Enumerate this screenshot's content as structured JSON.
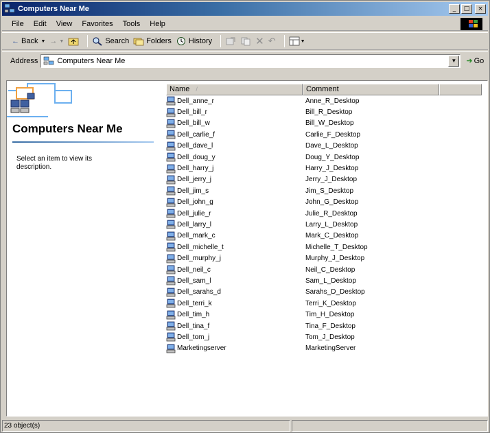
{
  "window": {
    "title": "Computers Near Me",
    "minimize": "_",
    "maximize": "□",
    "close": "×"
  },
  "menu": [
    "File",
    "Edit",
    "View",
    "Favorites",
    "Tools",
    "Help"
  ],
  "toolbar": {
    "back": "Back",
    "back_icon": "←",
    "forward_icon": "→",
    "search": "Search",
    "folders": "Folders",
    "history": "History"
  },
  "address": {
    "label": "Address",
    "value": "Computers Near Me",
    "go": "Go"
  },
  "left_pane": {
    "heading": "Computers Near Me",
    "description": "Select an item to view its description."
  },
  "columns": {
    "name": "Name",
    "comment": "Comment"
  },
  "items": [
    {
      "name": "Dell_anne_r",
      "comment": "Anne_R_Desktop"
    },
    {
      "name": "Dell_bill_r",
      "comment": "Bill_R_Desktop"
    },
    {
      "name": "Dell_bill_w",
      "comment": "Bill_W_Desktop"
    },
    {
      "name": "Dell_carlie_f",
      "comment": "Carlie_F_Desktop"
    },
    {
      "name": "Dell_dave_l",
      "comment": "Dave_L_Desktop"
    },
    {
      "name": "Dell_doug_y",
      "comment": "Doug_Y_Desktop"
    },
    {
      "name": "Dell_harry_j",
      "comment": "Harry_J_Desktop"
    },
    {
      "name": "Dell_jerry_j",
      "comment": "Jerry_J_Desktop"
    },
    {
      "name": "Dell_jim_s",
      "comment": "Jim_S_Desktop"
    },
    {
      "name": "Dell_john_g",
      "comment": "John_G_Desktop"
    },
    {
      "name": "Dell_julie_r",
      "comment": "Julie_R_Desktop"
    },
    {
      "name": "Dell_larry_l",
      "comment": "Larry_L_Desktop"
    },
    {
      "name": "Dell_mark_c",
      "comment": "Mark_C_Desktop"
    },
    {
      "name": "Dell_michelle_t",
      "comment": "Michelle_T_Desktop"
    },
    {
      "name": "Dell_murphy_j",
      "comment": "Murphy_J_Desktop"
    },
    {
      "name": "Dell_neil_c",
      "comment": "Neil_C_Desktop"
    },
    {
      "name": "Dell_sam_l",
      "comment": "Sam_L_Desktop"
    },
    {
      "name": "Dell_sarahs_d",
      "comment": "Sarahs_D_Desktop"
    },
    {
      "name": "Dell_terri_k",
      "comment": "Terri_K_Desktop"
    },
    {
      "name": "Dell_tim_h",
      "comment": "Tim_H_Desktop"
    },
    {
      "name": "Dell_tina_f",
      "comment": "Tina_F_Desktop"
    },
    {
      "name": "Dell_tom_j",
      "comment": "Tom_J_Desktop"
    },
    {
      "name": "Marketingserver",
      "comment": "MarketingServer"
    }
  ],
  "status": {
    "count": "23 object(s)"
  },
  "colors": {
    "titlebar_start": "#0a246a",
    "titlebar_end": "#a6caf0",
    "chrome": "#d4d0c8"
  }
}
